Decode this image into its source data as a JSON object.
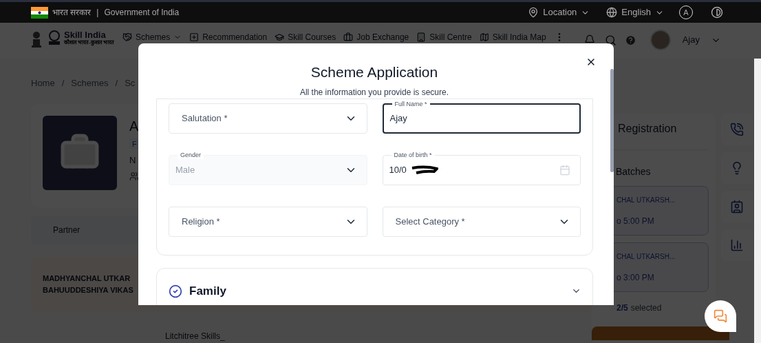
{
  "top_bar": {
    "government_hindi": "भारत सरकार",
    "separator": "|",
    "government": "Government of India",
    "location": "Location",
    "language": "English",
    "text_size_button": "A"
  },
  "nav": {
    "logo_title": "Skill India",
    "logo_tagline": "कौशल भारत-कुशल भारत",
    "items": [
      {
        "label": "Schemes",
        "kind": "dropdown"
      },
      {
        "label": "Recommendation",
        "kind": "link"
      },
      {
        "label": "Skill Courses",
        "kind": "link"
      },
      {
        "label": "Job Exchange",
        "kind": "link"
      },
      {
        "label": "Skill Centre",
        "kind": "link"
      },
      {
        "label": "Skill India Map",
        "kind": "link"
      }
    ],
    "user": "Ajay"
  },
  "breadcrumb": {
    "separator": "/",
    "items": [
      "Home",
      "Schemes",
      "Sc"
    ]
  },
  "scheme_card": {
    "title": "A",
    "tag": "F",
    "subtitle": "N"
  },
  "partners": {
    "header": "Partner",
    "rows": [
      {
        "lines": [
          "MADHYANCHAL UTKAR",
          "BAHUUDDESHIYA VIKAS"
        ]
      },
      {
        "lines": [
          "Litchitree Skills_"
        ]
      }
    ]
  },
  "registration": {
    "title": "Registration",
    "batches_title": "Batches",
    "batches": [
      {
        "name": "CHAL UTKARSH...",
        "time": "o 5:00 PM"
      },
      {
        "name": "CHAL UTKARSH...",
        "time": "o 3:00 PM"
      }
    ],
    "selected_count": "2/5",
    "selected_label": "selected"
  },
  "modal": {
    "title": "Scheme Application",
    "subtitle": "All the information you provide is secure.",
    "fields": [
      {
        "kind": "select",
        "placeholder": "Salutation *",
        "focused": false,
        "disabled": false
      },
      {
        "kind": "text",
        "label": "Full Name *",
        "value": "Ajay",
        "focused": true,
        "disabled": false
      },
      {
        "kind": "select",
        "label": "Gender",
        "value": "Male",
        "focused": false,
        "disabled": true
      },
      {
        "kind": "date",
        "label": "Date of birth *",
        "value": "10/0",
        "focused": false,
        "disabled": false
      },
      {
        "kind": "select",
        "placeholder": "Religion *",
        "focused": false,
        "disabled": false
      },
      {
        "kind": "select",
        "placeholder": "Select Category *",
        "focused": false,
        "disabled": false
      }
    ],
    "sections": [
      {
        "title": "Family",
        "completed": true,
        "expanded": false
      }
    ]
  }
}
